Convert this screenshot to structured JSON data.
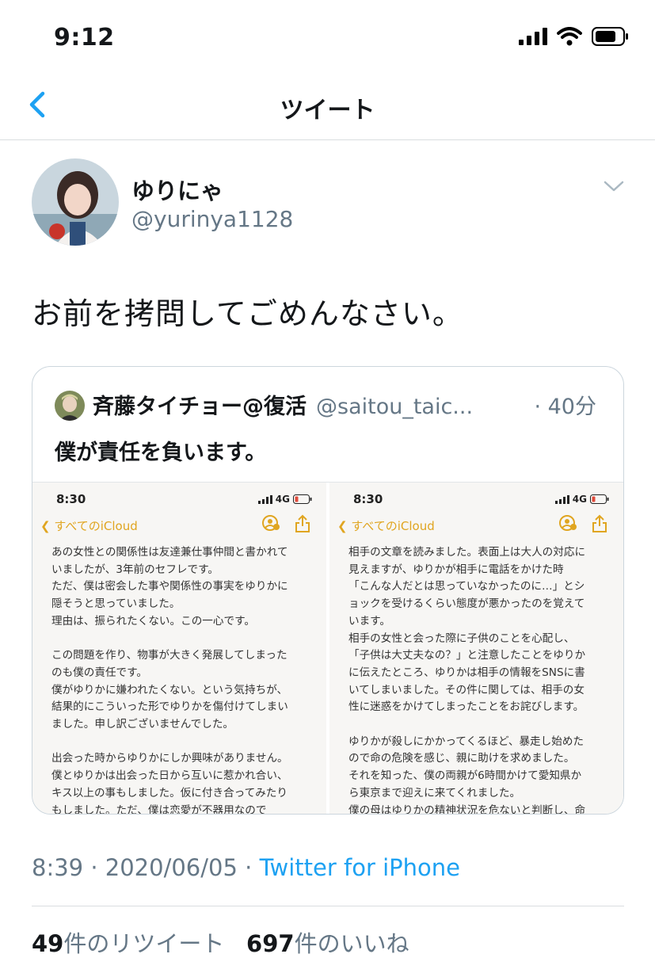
{
  "status_bar": {
    "time": "9:12"
  },
  "nav": {
    "title": "ツイート"
  },
  "tweet": {
    "author_name": "ゆりにゃ",
    "author_handle": "@yurinya1128",
    "text": "お前を拷問してごめんなさい。",
    "timestamp": "8:39 · 2020/06/05 · ",
    "source": "Twitter for iPhone",
    "retweets_count": "49",
    "retweets_label": "件のリツイート",
    "likes_count": "697",
    "likes_label": "件のいいね"
  },
  "quoted_tweet": {
    "author_name": "斉藤タイチョー@復活",
    "author_handle": "@saitou_taic...",
    "time": "· 40分",
    "text": "僕が責任を負います。",
    "screenshots": [
      {
        "time": "8:30",
        "network": "4G",
        "back_label": "すべてのiCloud",
        "lines": [
          "あの女性との関係性は友達兼仕事仲間と書かれて",
          "いましたが、3年前のセフレです。",
          "ただ、僕は密会した事や関係性の事実をゆりかに",
          "隠そうと思っていました。",
          "理由は、振られたくない。この一心です。",
          "",
          "この問題を作り、物事が大きく発展してしまった",
          "のも僕の責任です。",
          "僕がゆりかに嫌われたくない。という気持ちが、",
          "結果的にこういった形でゆりかを傷付けてしまい",
          "ました。申し訳ございませんでした。",
          "",
          "出会った時からゆりかにしか興味がありません。",
          "僕とゆりかは出会った日から互いに惹かれ合い、",
          "キス以上の事もしました。仮に付き合ってみたり",
          "もしました。ただ、僕は恋愛が不器用なので"
        ]
      },
      {
        "time": "8:30",
        "network": "4G",
        "back_label": "すべてのiCloud",
        "lines": [
          "相手の文章を読みました。表面上は大人の対応に",
          "見えますが、ゆりかが相手に電話をかけた時",
          "「こんな人だとは思っていなかったのに…」とシ",
          "ョックを受けるくらい態度が悪かったのを覚えて",
          "います。",
          "相手の女性と会った際に子供のことを心配し、",
          "「子供は大丈夫なの？」と注意したことをゆりか",
          "に伝えたところ、ゆりかは相手の情報をSNSに書",
          "いてしまいました。その件に関しては、相手の女",
          "性に迷惑をかけてしまったことをお詫びします。",
          "",
          "ゆりかが殺しにかかってくるほど、暴走し始めた",
          "ので命の危険を感じ、親に助けを求めました。",
          "それを知った、僕の両親が6時間かけて愛知県か",
          "ら東京まで迎えに来てくれました。",
          "僕の母はゆりかの精神状況を危ないと判断し、命"
        ]
      }
    ]
  },
  "colors": {
    "accent": "#1da1f2",
    "secondary_text": "#657786",
    "notes_yellow": "#e0a520"
  },
  "icons": [
    "signal-icon",
    "wifi-icon",
    "battery-icon",
    "back-chevron-icon",
    "chevron-down-icon",
    "share-icon",
    "collaborate-icon"
  ]
}
